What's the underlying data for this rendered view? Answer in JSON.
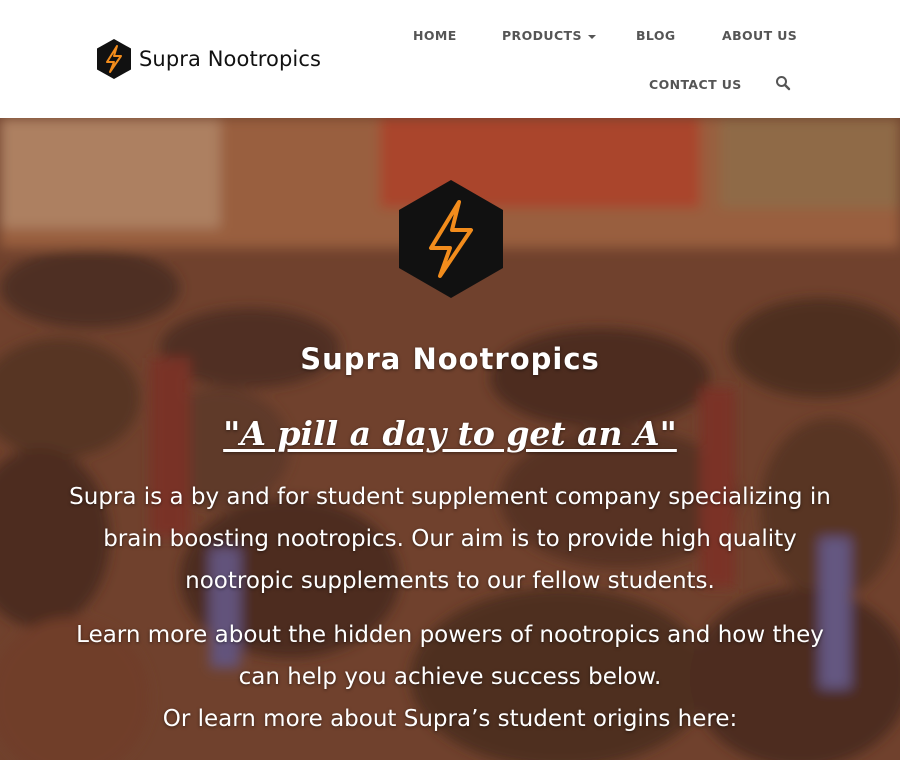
{
  "brand": {
    "name": "Supra Nootropics",
    "accent": "#f28c1c",
    "logo_bg": "#111111"
  },
  "nav": {
    "home": "HOME",
    "products": "PRODUCTS",
    "blog": "BLOG",
    "about": "ABOUT US",
    "contact": "CONTACT US",
    "search_icon": "search-icon"
  },
  "hero": {
    "title": "Supra Nootropics",
    "tagline": "\"A pill a day to get an A\"",
    "paragraph1": [
      "Supra is a by and for student supplement company specializing in",
      "brain boosting nootropics. Our aim is to provide high quality",
      "nootropic supplements to our fellow students."
    ],
    "paragraph2": [
      "Learn more about the hidden powers of nootropics and how they",
      "can help you achieve success below."
    ],
    "paragraph3": [
      "Or learn more about Supra’s student origins here:"
    ]
  }
}
